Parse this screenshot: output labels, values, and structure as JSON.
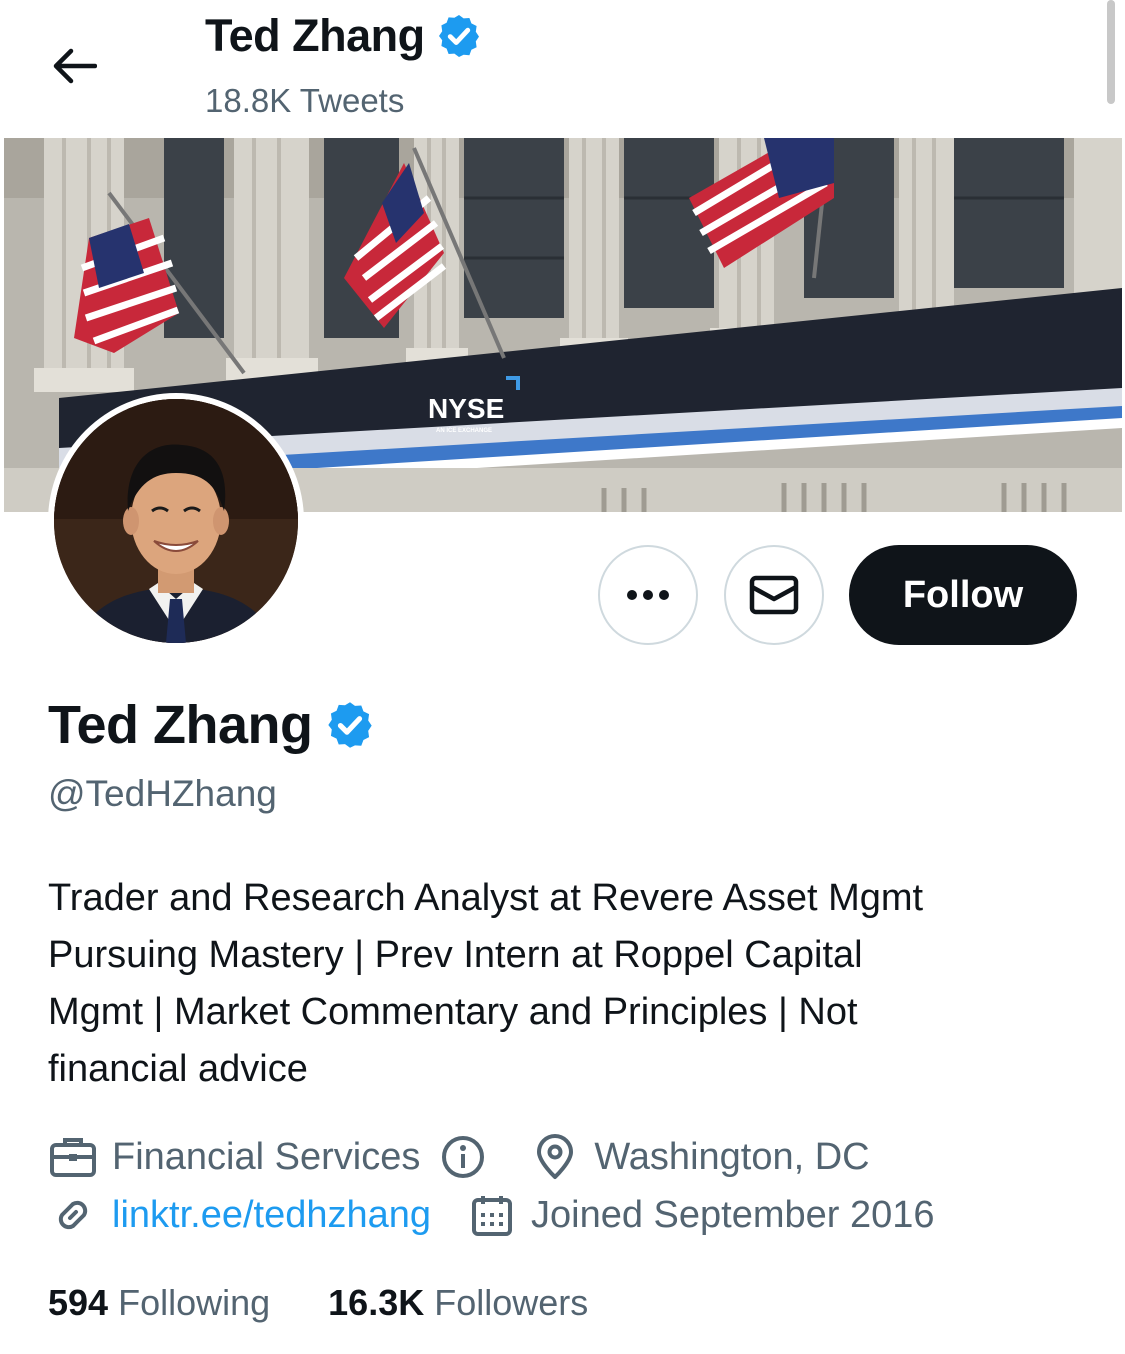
{
  "header": {
    "name": "Ted Zhang",
    "tweet_count": "18.8K Tweets"
  },
  "banner": {
    "sign_text": "NYSE",
    "sign_subtext": "AN ICE EXCHANGE"
  },
  "actions": {
    "follow_label": "Follow"
  },
  "profile": {
    "name": "Ted Zhang",
    "handle": "@TedHZhang",
    "bio_lines": [
      "Trader and Research Analyst at Revere Asset Mgmt",
      "Pursuing Mastery | Prev Intern at Roppel Capital",
      "Mgmt | Market Commentary and Principles | Not",
      "financial advice"
    ],
    "category": "Financial Services",
    "location": "Washington, DC",
    "website": "linktr.ee/tedhzhang",
    "joined": "Joined September 2016"
  },
  "stats": {
    "following_count": "594",
    "following_label": "Following",
    "followers_count": "16.3K",
    "followers_label": "Followers"
  },
  "colors": {
    "accent": "#1d9bf0",
    "text_primary": "#0f1419",
    "text_secondary": "#536471",
    "border": "#cfd9de"
  },
  "icons": [
    "back-arrow-icon",
    "verified-badge-icon",
    "more-icon",
    "mail-icon",
    "briefcase-icon",
    "info-icon",
    "location-pin-icon",
    "link-icon",
    "calendar-icon"
  ]
}
